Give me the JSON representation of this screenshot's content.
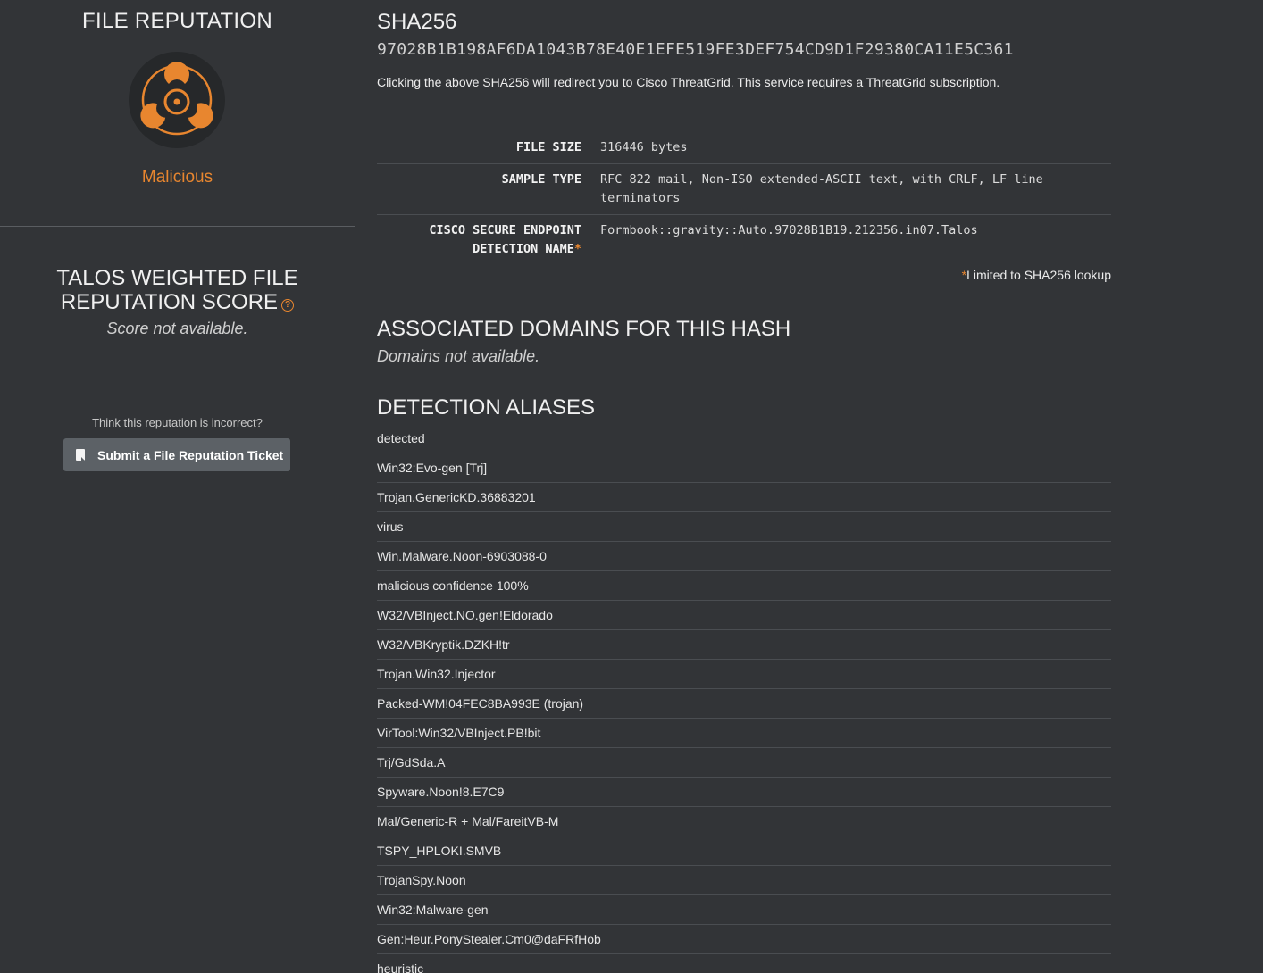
{
  "left_panel": {
    "file_reputation_title": "FILE REPUTATION",
    "verdict": "Malicious",
    "score_title": "TALOS WEIGHTED FILE REPUTATION SCORE",
    "score_help_glyph": "?",
    "score_not_available": "Score not available.",
    "incorrect_prompt": "Think this reputation is incorrect?",
    "ticket_button_label": "Submit a File Reputation Ticket"
  },
  "sha": {
    "title": "SHA256",
    "value": "97028B1B198AF6DA1043B78E40E1EFE519FE3DEF754CD9D1F29380CA11E5C361",
    "note": "Clicking the above SHA256 will redirect you to Cisco ThreatGrid. This service requires a ThreatGrid subscription."
  },
  "info": {
    "file_size_label": "FILE SIZE",
    "file_size_value": "316446 bytes",
    "sample_type_label": "SAMPLE TYPE",
    "sample_type_value": "RFC 822 mail, Non-ISO extended-ASCII text, with CRLF, LF line terminators",
    "detection_name_label": "CISCO SECURE ENDPOINT DETECTION NAME",
    "detection_name_value": "Formbook::gravity::Auto.97028B1B19.212356.in07.Talos",
    "asterisk": "*",
    "limited_note": "Limited to SHA256 lookup"
  },
  "domains": {
    "title": "ASSOCIATED DOMAINS FOR THIS HASH",
    "not_available": "Domains not available."
  },
  "aliases": {
    "title": "DETECTION ALIASES",
    "items": [
      "detected",
      "Win32:Evo-gen [Trj]",
      "Trojan.GenericKD.36883201",
      "virus",
      "Win.Malware.Noon-6903088-0",
      "malicious confidence 100%",
      "W32/VBInject.NO.gen!Eldorado",
      "W32/VBKryptik.DZKH!tr",
      "Trojan.Win32.Injector",
      "Packed-WM!04FEC8BA993E (trojan)",
      "VirTool:Win32/VBInject.PB!bit",
      "Trj/GdSda.A",
      "Spyware.Noon!8.E7C9",
      "Mal/Generic-R + Mal/FareitVB-M",
      "TSPY_HPLOKI.SMVB",
      "TrojanSpy.Noon",
      "Win32:Malware-gen",
      "Gen:Heur.PonyStealer.Cm0@daFRfHob",
      "heuristic"
    ]
  },
  "colors": {
    "background": "#323437",
    "accent": "#e8862f",
    "button": "#5c6166"
  },
  "icons": {
    "biohazard": "biohazard-icon",
    "help": "help-circle-icon",
    "ticket": "document-icon"
  }
}
